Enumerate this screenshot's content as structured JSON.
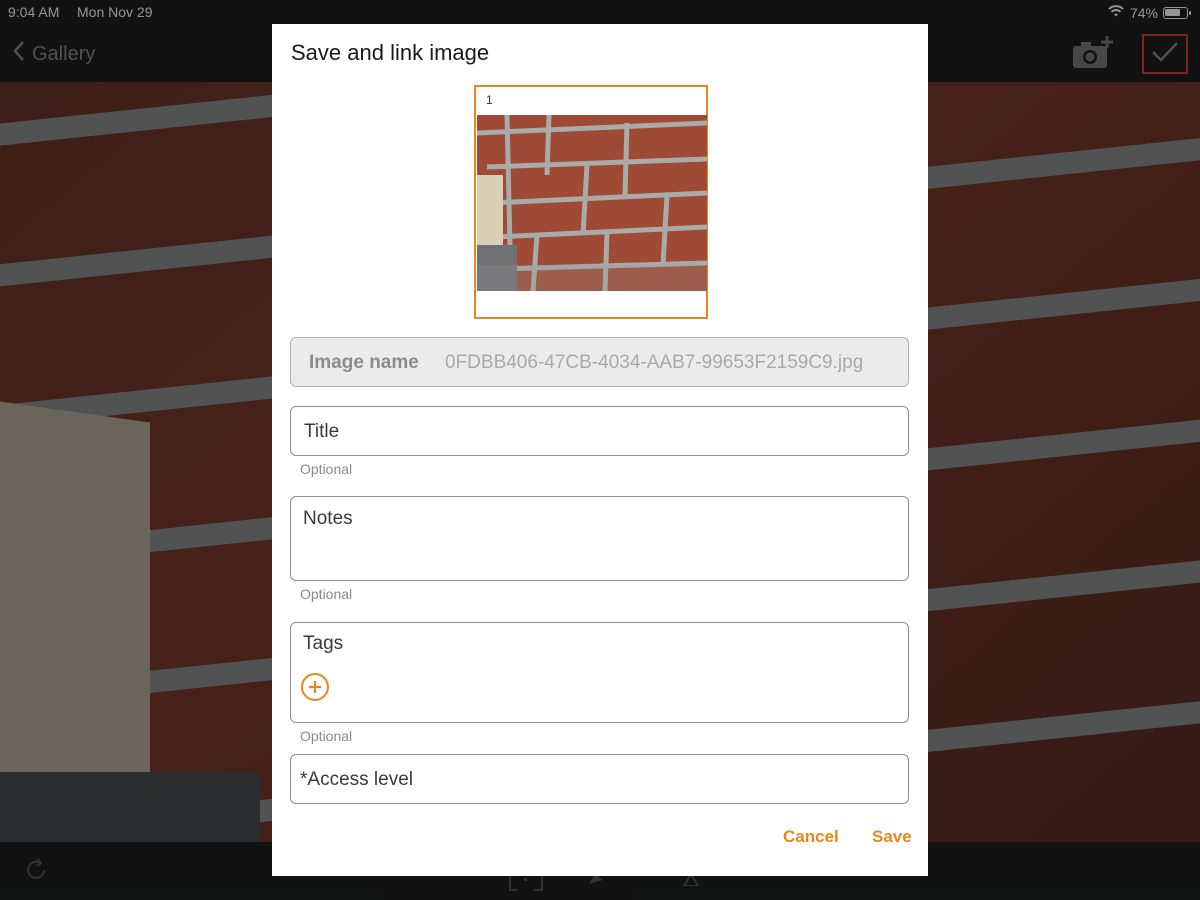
{
  "status": {
    "time": "9:04 AM",
    "date": "Mon Nov 29",
    "battery": "74%"
  },
  "nav": {
    "back_label": "Gallery"
  },
  "dialog": {
    "title": "Save and link image",
    "thumbnail_index": "1",
    "image_name": {
      "label": "Image name",
      "value": "0FDBB406-47CB-4034-AAB7-99653F2159C9.jpg"
    },
    "title_field": {
      "label": "Title",
      "hint": "Optional"
    },
    "notes_field": {
      "label": "Notes",
      "hint": "Optional"
    },
    "tags_field": {
      "label": "Tags",
      "hint": "Optional"
    },
    "access_field": {
      "label": "*Access level"
    },
    "cancel_label": "Cancel",
    "save_label": "Save"
  },
  "colors": {
    "accent": "#e8861e",
    "highlight_border": "#e03b3b",
    "chrome": "#1f2021"
  }
}
